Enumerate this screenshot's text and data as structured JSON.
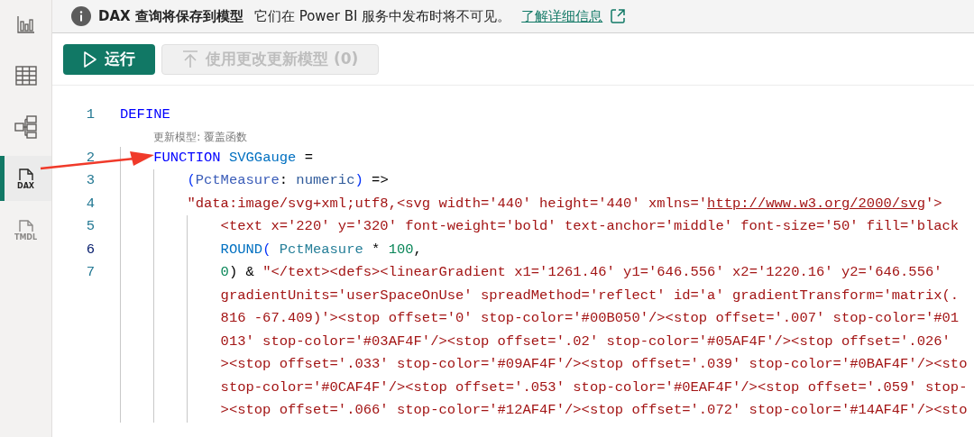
{
  "sidebar": {
    "items": [
      {
        "kind": "report",
        "selected": false
      },
      {
        "kind": "table",
        "selected": false
      },
      {
        "kind": "model",
        "selected": false
      },
      {
        "kind": "file",
        "label": "DAX",
        "selected": true
      },
      {
        "kind": "file",
        "label": "TMDL",
        "selected": false
      }
    ]
  },
  "banner": {
    "title": "DAX 查询将保存到模型",
    "message": "它们在 Power BI 服务中发布时将不可见。",
    "link": "了解详细信息"
  },
  "toolbar": [
    {
      "kind": "run",
      "label": "运行",
      "disabled": false
    },
    {
      "kind": "update",
      "label": "使用更改更新模型 (0)",
      "disabled": true
    }
  ],
  "editor": {
    "rows": [
      {
        "kind": "line",
        "number": "1",
        "current": false,
        "tokens": [
          {
            "kind": "keyword",
            "text": "DEFINE"
          }
        ],
        "children": [
          {
            "kind": "annotation",
            "text": "更新模型: 覆盖函数"
          },
          {
            "kind": "line",
            "number": "2",
            "current": false,
            "tokens": [
              {
                "kind": "keyword",
                "text": "FUNCTION"
              },
              {
                "kind": "function",
                "text": " SVGGauge"
              },
              {
                "kind": "plain",
                "text": " ="
              }
            ],
            "children": [
              {
                "kind": "line",
                "number": "3",
                "current": false,
                "tokens": [
                  {
                    "kind": "paren",
                    "text": "("
                  },
                  {
                    "kind": "param",
                    "text": "PctMeasure"
                  },
                  {
                    "kind": "plain",
                    "text": ": "
                  },
                  {
                    "kind": "type",
                    "text": "numeric"
                  },
                  {
                    "kind": "paren",
                    "text": ")"
                  },
                  {
                    "kind": "plain",
                    "text": " =>"
                  }
                ]
              },
              {
                "kind": "line",
                "number": "4",
                "current": false,
                "tokens": [
                  {
                    "kind": "string",
                    "text": "\"data:image/svg+xml;utf8,<svg width='440' height='440' xmlns='"
                  },
                  {
                    "kind": "link",
                    "text": "http://www.w3.org/2000/svg"
                  },
                  {
                    "kind": "string",
                    "text": "'>"
                  }
                ],
                "children": [
                  {
                    "kind": "line",
                    "number": "5",
                    "current": false,
                    "tokens": [
                      {
                        "kind": "string",
                        "text": "<text x='220' y='320' font-weight='bold' text-anchor='middle' font-size='50' fill='black"
                      }
                    ]
                  },
                  {
                    "kind": "line",
                    "number": "6",
                    "current": true,
                    "tokens": [
                      {
                        "kind": "function",
                        "text": "ROUND"
                      },
                      {
                        "kind": "paren",
                        "text": "("
                      },
                      {
                        "kind": "param2",
                        "text": " PctMeasure"
                      },
                      {
                        "kind": "plain",
                        "text": " * "
                      },
                      {
                        "kind": "number",
                        "text": "100"
                      },
                      {
                        "kind": "plain",
                        "text": ","
                      }
                    ]
                  },
                  {
                    "kind": "line",
                    "number": "7",
                    "current": false,
                    "tokens": [
                      {
                        "kind": "number",
                        "text": "0"
                      },
                      {
                        "kind": "plain",
                        "text": ") & "
                      },
                      {
                        "kind": "string",
                        "text": "\"</text><defs><linearGradient x1='1261.46' y1='646.556' x2='1220.16' y2='646.556'"
                      }
                    ],
                    "wraps": [
                      "gradientUnits='userSpaceOnUse' spreadMethod='reflect' id='a' gradientTransform='matrix(.",
                      "816 -67.409)'><stop offset='0' stop-color='#00B050'/><stop offset='.007' stop-color='#01",
                      "013' stop-color='#03AF4F'/><stop offset='.02' stop-color='#05AF4F'/><stop offset='.026'",
                      "><stop offset='.033' stop-color='#09AF4F'/><stop offset='.039' stop-color='#0BAF4F'/><sto",
                      "stop-color='#0CAF4F'/><stop offset='.053' stop-color='#0EAF4F'/><stop offset='.059' stop-",
                      "><stop offset='.066' stop-color='#12AF4F'/><stop offset='.072' stop-color='#14AF4F'/><sto"
                    ]
                  }
                ]
              }
            ]
          }
        ]
      }
    ]
  }
}
